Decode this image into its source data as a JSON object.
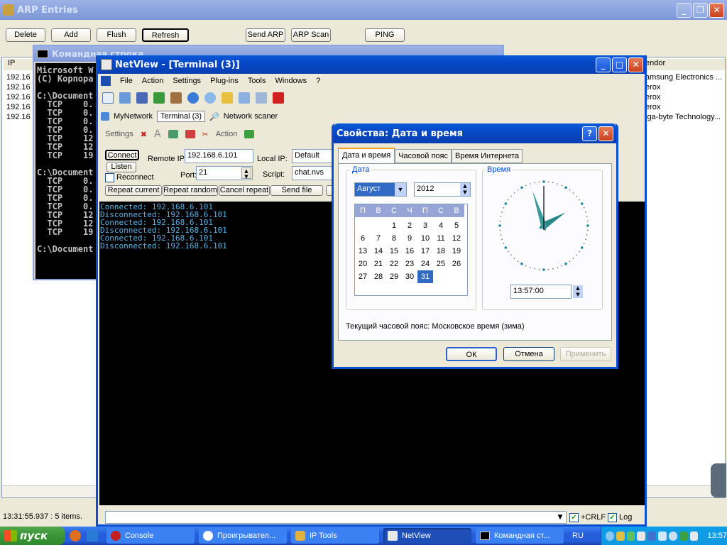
{
  "arp": {
    "title": "ARP Entries",
    "buttons": [
      "Delete",
      "Add",
      "Flush",
      "Refresh",
      "Send ARP",
      "ARP Scan",
      "PING"
    ],
    "col_ip": "IP",
    "col_vendor": "endor",
    "rows_ip": [
      "192.16",
      "192.16",
      "192.16",
      "192.16",
      "192.16"
    ],
    "rows_vendor": [
      "amsung Electronics ...",
      "erox",
      "erox",
      "erox",
      "iga-byte Technology..."
    ],
    "status": "13:31:55.937 : 5 items."
  },
  "cmd": {
    "title": "Командная строка",
    "lines": [
      "Microsoft W",
      "(C) Корпора",
      "",
      "C:\\Document",
      "  TCP    0.",
      "  TCP    0.",
      "  TCP    0.",
      "  TCP    0.",
      "  TCP    12",
      "  TCP    12",
      "  TCP    19",
      "",
      "C:\\Document",
      "  TCP    0.",
      "  TCP    0.",
      "  TCP    0.",
      "  TCP    0.",
      "  TCP    12",
      "  TCP    12",
      "  TCP    19",
      "",
      "C:\\Document"
    ]
  },
  "netview": {
    "title": "NetView - [Terminal (3)]",
    "menu": [
      "File",
      "Action",
      "Settings",
      "Plug-ins",
      "Tools",
      "Windows",
      "?"
    ],
    "tabs": [
      "MyNetwork",
      "Terminal (3)",
      "Network scaner"
    ],
    "toolbar_settings": "Settings",
    "toolbar_action": "Action",
    "connect": "Connect",
    "listen": "Listen",
    "reconnect": "Reconnect",
    "remote_ip_label": "Remote IP:",
    "remote_ip": "192.168.6.101",
    "local_ip_label": "Local IP:",
    "local_ip": "Default",
    "port_label": "Port:",
    "port": "21",
    "script_label": "Script:",
    "script": "chat.nvs",
    "repeat_current": "Repeat current",
    "repeat_random": "Repeat random",
    "cancel_repeat": "Cancel repeat",
    "send_file": "Send file",
    "log_lines": [
      "Connected: 192.168.6.101",
      "Disconnected: 192.168.6.101",
      "Connected: 192.168.6.101",
      "Disconnected: 192.168.6.101",
      "Connected: 192.168.6.101",
      "Disconnected: 192.168.6.101"
    ],
    "crlf": "+CRLF",
    "log": "Log"
  },
  "dialog": {
    "title": "Свойства: Дата и время",
    "tabs": [
      "Дата и время",
      "Часовой пояс",
      "Время Интернета"
    ],
    "date_group": "Дата",
    "time_group": "Время",
    "month": "Август",
    "year": "2012",
    "weekdays": [
      "П",
      "В",
      "С",
      "Ч",
      "П",
      "С",
      "В"
    ],
    "weeks": [
      [
        "",
        "",
        "1",
        "2",
        "3",
        "4",
        "5"
      ],
      [
        "6",
        "7",
        "8",
        "9",
        "10",
        "11",
        "12"
      ],
      [
        "13",
        "14",
        "15",
        "16",
        "17",
        "18",
        "19"
      ],
      [
        "20",
        "21",
        "22",
        "23",
        "24",
        "25",
        "26"
      ],
      [
        "27",
        "28",
        "29",
        "30",
        "31",
        "",
        ""
      ]
    ],
    "selected_day": "31",
    "time": "13:57:00",
    "tz_text": "Текущий часовой пояс: Московское время (зима)",
    "ok": "ОК",
    "cancel": "Отмена",
    "apply": "Применить",
    "clock_hours": 13,
    "clock_minutes": 57
  },
  "taskbar": {
    "start": "пуск",
    "items": [
      "Console",
      "Проигрывател...",
      "IP Tools",
      "NetView",
      "Командная ст..."
    ],
    "lang": "RU",
    "clock": "13:57"
  }
}
